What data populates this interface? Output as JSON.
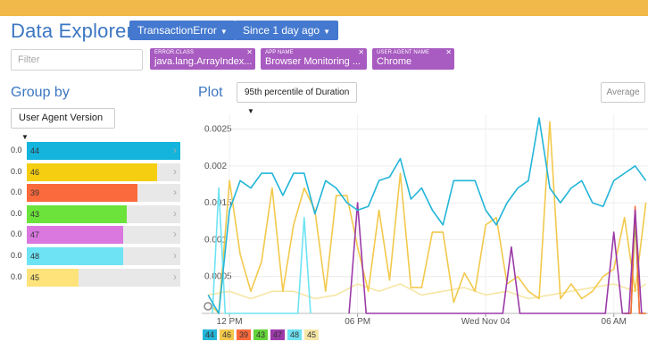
{
  "header": {
    "title": "Data Explorer",
    "event_type": "TransactionError",
    "time_range": "Since 1 day ago"
  },
  "filter": {
    "placeholder": "Filter",
    "value": ""
  },
  "filters": [
    {
      "key": "ERROR.CLASS",
      "value": "java.lang.ArrayIndex..."
    },
    {
      "key": "APP NAME",
      "value": "Browser Monitoring ..."
    },
    {
      "key": "USER AGENT NAME",
      "value": "Chrome"
    }
  ],
  "group": {
    "title": "Group by",
    "selected": "User Agent Version",
    "rows": [
      {
        "label": "0.0",
        "value": "44",
        "fraction": 1.0,
        "color": "#14b4dc"
      },
      {
        "label": "0.0",
        "value": "46",
        "fraction": 0.85,
        "color": "#f5ce12"
      },
      {
        "label": "0.0",
        "value": "39",
        "fraction": 0.72,
        "color": "#fb6a3c"
      },
      {
        "label": "0.0",
        "value": "43",
        "fraction": 0.65,
        "color": "#6be33a"
      },
      {
        "label": "0.0",
        "value": "47",
        "fraction": 0.63,
        "color": "#da78e0"
      },
      {
        "label": "0.0",
        "value": "48",
        "fraction": 0.63,
        "color": "#6ee3f3"
      },
      {
        "label": "0.0",
        "value": "45",
        "fraction": 0.34,
        "color": "#fde37a"
      }
    ]
  },
  "plot": {
    "title": "Plot",
    "metric": "95th percentile of Duration",
    "mode_button": "Average"
  },
  "chart_data": {
    "type": "line",
    "title": "",
    "xlabel": "",
    "ylabel": "",
    "ylim": [
      0,
      0.0027
    ],
    "y_ticks": [
      "0.0025",
      "0.002",
      "0.0015",
      "0.001",
      "0.0005"
    ],
    "y_tick_values": [
      0.0025,
      0.002,
      0.0015,
      0.001,
      0.0005
    ],
    "x_range_hours": [
      -1.3,
      19.6
    ],
    "x_ticks": [
      {
        "label": "12 PM",
        "hour": 0
      },
      {
        "label": "06 PM",
        "hour": 6
      },
      {
        "label": "Wed Nov 04",
        "hour": 12
      },
      {
        "label": "06 AM",
        "hour": 18
      }
    ],
    "grid": true,
    "legend": "bottom",
    "series": [
      {
        "name": "44",
        "color": "#22b5d8",
        "x": [
          -1.0,
          -0.5,
          0.0,
          0.5,
          1.0,
          1.5,
          2.0,
          2.5,
          3.0,
          3.5,
          4.0,
          4.5,
          5.0,
          5.5,
          6.0,
          6.5,
          7.0,
          7.5,
          8.0,
          8.5,
          9.0,
          9.5,
          10.0,
          10.5,
          11.0,
          11.5,
          12.0,
          12.5,
          13.0,
          13.5,
          14.0,
          14.5,
          15.0,
          15.5,
          16.0,
          16.5,
          17.0,
          17.5,
          18.0,
          18.5,
          19.0,
          19.5
        ],
        "values": [
          0.00025,
          0.0,
          0.0014,
          0.0018,
          0.0017,
          0.0019,
          0.0019,
          0.0016,
          0.0019,
          0.0019,
          0.00135,
          0.0018,
          0.0017,
          0.0015,
          0.0014,
          0.00145,
          0.0018,
          0.00185,
          0.0021,
          0.00155,
          0.0017,
          0.0014,
          0.0012,
          0.0018,
          0.0018,
          0.0018,
          0.0014,
          0.0012,
          0.0015,
          0.0017,
          0.0018,
          0.00265,
          0.0017,
          0.0015,
          0.0017,
          0.0018,
          0.0015,
          0.00145,
          0.0018,
          0.0019,
          0.002,
          0.0018
        ]
      },
      {
        "name": "46",
        "color": "#f2c94c",
        "x": [
          -1.0,
          -0.5,
          0.0,
          0.5,
          1.0,
          1.5,
          2.0,
          2.5,
          3.0,
          3.5,
          4.0,
          4.5,
          5.0,
          5.5,
          6.0,
          6.5,
          7.0,
          7.5,
          8.0,
          8.5,
          9.0,
          9.5,
          10.0,
          10.5,
          11.0,
          11.5,
          12.0,
          12.5,
          13.0,
          13.5,
          14.0,
          14.5,
          15.0,
          15.5,
          16.0,
          16.5,
          17.0,
          17.5,
          18.0,
          18.5,
          19.0,
          19.5
        ],
        "values": [
          0.00015,
          0.0,
          0.0018,
          0.0008,
          0.0003,
          0.0007,
          0.0017,
          0.0003,
          0.0012,
          0.0017,
          0.0014,
          0.0003,
          0.0016,
          0.0016,
          0.0009,
          0.0003,
          0.0014,
          0.00045,
          0.0019,
          0.00035,
          0.00035,
          0.0011,
          0.0011,
          0.00015,
          0.00055,
          0.0003,
          0.0012,
          0.0013,
          0.0004,
          0.0005,
          0.0003,
          0.0002,
          0.0026,
          0.0002,
          0.0004,
          0.0002,
          0.0003,
          0.0005,
          0.0006,
          0.0013,
          0.0003,
          0.0015
        ]
      },
      {
        "name": "39",
        "color": "#fb6a3c",
        "x": [
          18.5,
          18.8,
          19.0,
          19.2,
          19.5
        ],
        "values": [
          0.0,
          0.0,
          0.00145,
          0.0,
          0.0
        ]
      },
      {
        "name": "43",
        "color": "#63d33a",
        "x": [
          18.5,
          18.8,
          19.0,
          19.2,
          19.5
        ],
        "values": [
          0.0,
          0.0,
          0.0013,
          0.0,
          0.0
        ]
      },
      {
        "name": "47",
        "color": "#9b3aa8",
        "x": [
          5.6,
          6.0,
          6.4,
          12.8,
          13.2,
          13.6,
          17.6,
          18.0,
          18.4,
          18.7,
          19.0,
          19.3
        ],
        "values": [
          0.0,
          0.0015,
          0.0,
          0.0,
          0.0009,
          0.0,
          0.0,
          0.0011,
          0.0,
          0.0,
          0.0014,
          0.0
        ]
      },
      {
        "name": "48",
        "color": "#6ee3f3",
        "x": [
          -0.8,
          -0.5,
          -0.2,
          3.2,
          3.5,
          3.8
        ],
        "values": [
          0.0,
          0.0017,
          0.0,
          0.0,
          0.0013,
          0.0
        ]
      },
      {
        "name": "45",
        "color": "#f6e6a6",
        "x": [
          -1.0,
          0.0,
          1.0,
          2.0,
          3.0,
          4.0,
          5.0,
          6.0,
          7.0,
          8.0,
          9.0,
          10.0,
          11.0,
          12.0,
          13.0,
          14.0,
          15.0,
          16.0,
          17.0,
          18.0,
          19.0,
          19.5
        ],
        "values": [
          0.00025,
          0.0003,
          0.0002,
          0.0003,
          0.0003,
          0.0002,
          0.00025,
          0.0004,
          0.0003,
          0.0004,
          0.00025,
          0.0003,
          0.00035,
          0.00025,
          0.0003,
          0.0002,
          0.00025,
          0.0003,
          0.00035,
          0.0004,
          0.0003,
          0.0004
        ]
      }
    ]
  }
}
